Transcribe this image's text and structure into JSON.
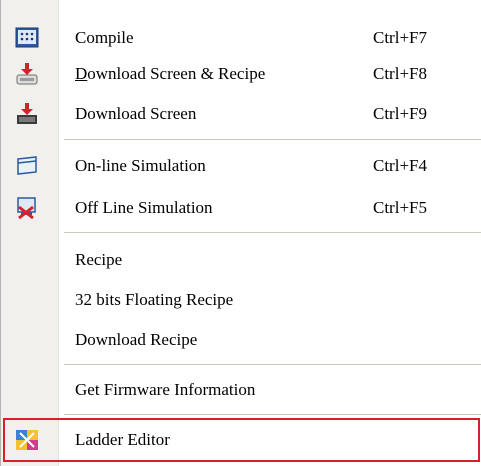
{
  "menu": {
    "items": [
      {
        "label": "Compile",
        "shortcut": "Ctrl+F7",
        "icon": "compile-icon"
      },
      {
        "label_underlined": "D",
        "label_rest": "ownload Screen & Recipe",
        "shortcut": "Ctrl+F8",
        "icon": "download-screen-recipe-icon"
      },
      {
        "label": "Download Screen",
        "shortcut": "Ctrl+F9",
        "icon": "download-screen-icon"
      },
      {
        "label": "On-line Simulation",
        "shortcut": "Ctrl+F4",
        "icon": "online-simulation-icon"
      },
      {
        "label": "Off Line Simulation",
        "shortcut": "Ctrl+F5",
        "icon": "offline-simulation-icon"
      },
      {
        "label": "Recipe"
      },
      {
        "label": "32 bits Floating Recipe"
      },
      {
        "label": "Download Recipe"
      },
      {
        "label": "Get Firmware Information"
      },
      {
        "label": "Ladder Editor",
        "icon": "ladder-editor-icon"
      }
    ],
    "highlighted_item": "Ladder Editor",
    "highlight_color": "#d8202a"
  }
}
